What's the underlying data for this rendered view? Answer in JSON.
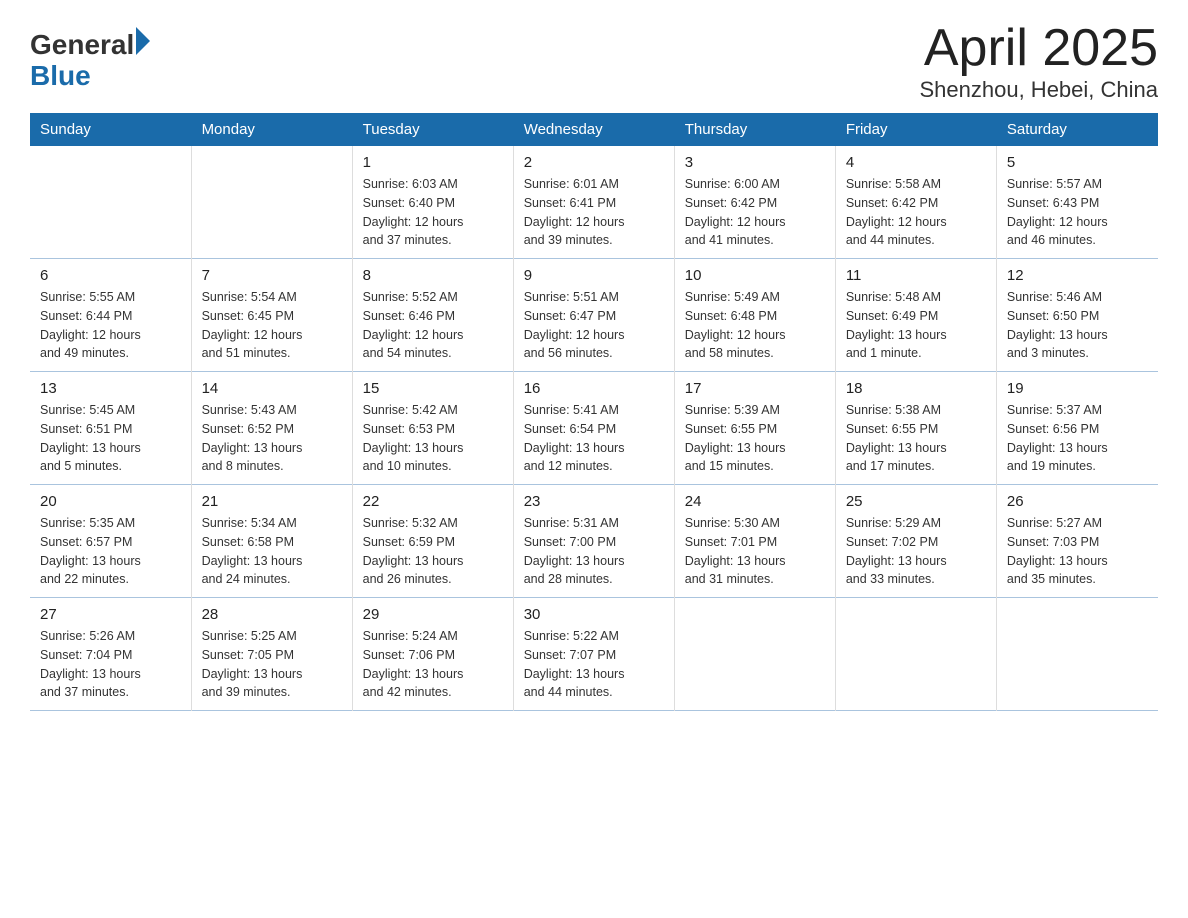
{
  "header": {
    "logo_general": "General",
    "logo_blue": "Blue",
    "title": "April 2025",
    "subtitle": "Shenzhou, Hebei, China"
  },
  "weekdays": [
    "Sunday",
    "Monday",
    "Tuesday",
    "Wednesday",
    "Thursday",
    "Friday",
    "Saturday"
  ],
  "weeks": [
    [
      {
        "day": "",
        "info": ""
      },
      {
        "day": "",
        "info": ""
      },
      {
        "day": "1",
        "info": "Sunrise: 6:03 AM\nSunset: 6:40 PM\nDaylight: 12 hours\nand 37 minutes."
      },
      {
        "day": "2",
        "info": "Sunrise: 6:01 AM\nSunset: 6:41 PM\nDaylight: 12 hours\nand 39 minutes."
      },
      {
        "day": "3",
        "info": "Sunrise: 6:00 AM\nSunset: 6:42 PM\nDaylight: 12 hours\nand 41 minutes."
      },
      {
        "day": "4",
        "info": "Sunrise: 5:58 AM\nSunset: 6:42 PM\nDaylight: 12 hours\nand 44 minutes."
      },
      {
        "day": "5",
        "info": "Sunrise: 5:57 AM\nSunset: 6:43 PM\nDaylight: 12 hours\nand 46 minutes."
      }
    ],
    [
      {
        "day": "6",
        "info": "Sunrise: 5:55 AM\nSunset: 6:44 PM\nDaylight: 12 hours\nand 49 minutes."
      },
      {
        "day": "7",
        "info": "Sunrise: 5:54 AM\nSunset: 6:45 PM\nDaylight: 12 hours\nand 51 minutes."
      },
      {
        "day": "8",
        "info": "Sunrise: 5:52 AM\nSunset: 6:46 PM\nDaylight: 12 hours\nand 54 minutes."
      },
      {
        "day": "9",
        "info": "Sunrise: 5:51 AM\nSunset: 6:47 PM\nDaylight: 12 hours\nand 56 minutes."
      },
      {
        "day": "10",
        "info": "Sunrise: 5:49 AM\nSunset: 6:48 PM\nDaylight: 12 hours\nand 58 minutes."
      },
      {
        "day": "11",
        "info": "Sunrise: 5:48 AM\nSunset: 6:49 PM\nDaylight: 13 hours\nand 1 minute."
      },
      {
        "day": "12",
        "info": "Sunrise: 5:46 AM\nSunset: 6:50 PM\nDaylight: 13 hours\nand 3 minutes."
      }
    ],
    [
      {
        "day": "13",
        "info": "Sunrise: 5:45 AM\nSunset: 6:51 PM\nDaylight: 13 hours\nand 5 minutes."
      },
      {
        "day": "14",
        "info": "Sunrise: 5:43 AM\nSunset: 6:52 PM\nDaylight: 13 hours\nand 8 minutes."
      },
      {
        "day": "15",
        "info": "Sunrise: 5:42 AM\nSunset: 6:53 PM\nDaylight: 13 hours\nand 10 minutes."
      },
      {
        "day": "16",
        "info": "Sunrise: 5:41 AM\nSunset: 6:54 PM\nDaylight: 13 hours\nand 12 minutes."
      },
      {
        "day": "17",
        "info": "Sunrise: 5:39 AM\nSunset: 6:55 PM\nDaylight: 13 hours\nand 15 minutes."
      },
      {
        "day": "18",
        "info": "Sunrise: 5:38 AM\nSunset: 6:55 PM\nDaylight: 13 hours\nand 17 minutes."
      },
      {
        "day": "19",
        "info": "Sunrise: 5:37 AM\nSunset: 6:56 PM\nDaylight: 13 hours\nand 19 minutes."
      }
    ],
    [
      {
        "day": "20",
        "info": "Sunrise: 5:35 AM\nSunset: 6:57 PM\nDaylight: 13 hours\nand 22 minutes."
      },
      {
        "day": "21",
        "info": "Sunrise: 5:34 AM\nSunset: 6:58 PM\nDaylight: 13 hours\nand 24 minutes."
      },
      {
        "day": "22",
        "info": "Sunrise: 5:32 AM\nSunset: 6:59 PM\nDaylight: 13 hours\nand 26 minutes."
      },
      {
        "day": "23",
        "info": "Sunrise: 5:31 AM\nSunset: 7:00 PM\nDaylight: 13 hours\nand 28 minutes."
      },
      {
        "day": "24",
        "info": "Sunrise: 5:30 AM\nSunset: 7:01 PM\nDaylight: 13 hours\nand 31 minutes."
      },
      {
        "day": "25",
        "info": "Sunrise: 5:29 AM\nSunset: 7:02 PM\nDaylight: 13 hours\nand 33 minutes."
      },
      {
        "day": "26",
        "info": "Sunrise: 5:27 AM\nSunset: 7:03 PM\nDaylight: 13 hours\nand 35 minutes."
      }
    ],
    [
      {
        "day": "27",
        "info": "Sunrise: 5:26 AM\nSunset: 7:04 PM\nDaylight: 13 hours\nand 37 minutes."
      },
      {
        "day": "28",
        "info": "Sunrise: 5:25 AM\nSunset: 7:05 PM\nDaylight: 13 hours\nand 39 minutes."
      },
      {
        "day": "29",
        "info": "Sunrise: 5:24 AM\nSunset: 7:06 PM\nDaylight: 13 hours\nand 42 minutes."
      },
      {
        "day": "30",
        "info": "Sunrise: 5:22 AM\nSunset: 7:07 PM\nDaylight: 13 hours\nand 44 minutes."
      },
      {
        "day": "",
        "info": ""
      },
      {
        "day": "",
        "info": ""
      },
      {
        "day": "",
        "info": ""
      }
    ]
  ]
}
